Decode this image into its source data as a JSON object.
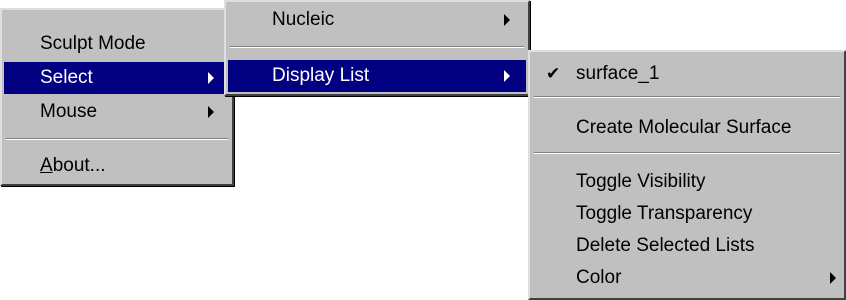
{
  "menu_main": {
    "items": [
      {
        "label": "Sculpt Mode"
      },
      {
        "label": "Select"
      },
      {
        "label": "Mouse"
      },
      {
        "label_mnemonic": "A",
        "label_rest": "bout..."
      }
    ]
  },
  "menu_select": {
    "items": [
      {
        "label": "Nucleic"
      },
      {
        "label": "Display List"
      }
    ]
  },
  "menu_display_list": {
    "items": [
      {
        "label": "surface_1",
        "checked": true
      },
      {
        "label": "Create Molecular Surface"
      },
      {
        "label": "Toggle Visibility"
      },
      {
        "label": "Toggle Transparency"
      },
      {
        "label": "Delete Selected Lists"
      },
      {
        "label": "Color"
      }
    ]
  },
  "icons": {
    "check": "✔",
    "check_name": "checkmark-icon",
    "submenu_arrow_name": "submenu-arrow-icon"
  },
  "colors": {
    "menu_bg": "#c0c0c0",
    "highlight": "#000080",
    "highlight_text": "#ffffff"
  }
}
